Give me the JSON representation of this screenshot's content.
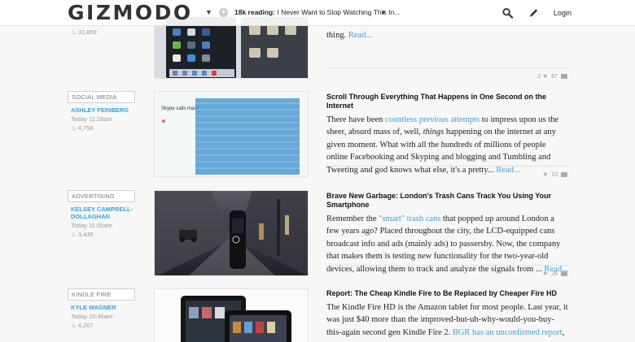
{
  "header": {
    "logo": "GIZMODO",
    "reading_count": "18k reading:",
    "reading_title": "I Never Want to Stop Watching This In...",
    "login": "Login"
  },
  "top_partial": {
    "views": "31,859",
    "body_tail": "thing.",
    "read_more": "Read...",
    "stars": "2",
    "comments": "67"
  },
  "articles": [
    {
      "category": "SOCIAL MEDIA",
      "author": "ASHLEY FEINBERG",
      "time": "Today 11:28am",
      "views": "4,756",
      "title": "Scroll Through Everything That Happens in One Second on the Internet",
      "body_pre": "There have been ",
      "link": "countless previous attempts",
      "body_post": " to impress upon us the sheer, absurd mass of, well, ",
      "em": "things",
      "body_end": " happening on the internet at any given moment. What with all the hundreds of millions of people online Facebooking and Skyping and blogging and Tumbling and Tweeting and god knows what else, it's a pretty... ",
      "read_more": "Read...",
      "comments": "13",
      "thumb_caption": "Skype calls made"
    },
    {
      "category": "ADVERTISING",
      "author": "KELSEY CAMPBELL-DOLLAGHAN",
      "time": "Today 11:00am",
      "views": "3,436",
      "title": "Brave New Garbage: London's Trash Cans Track You Using Your Smartphone",
      "body_pre": "Remember the ",
      "link": "\"smart\" trash cans",
      "body_post": " that popped up around London a few years ago? Placed throughout the city, the LCD-equipped cans broadcast info and ads (mainly ads) to passersby. Now, the company that makes them is testing new functionality for the two-year-old devices, allowing them to track and analyze the signals from ... ",
      "read_more": "Read...",
      "comments": "26"
    },
    {
      "category": "KINDLE FIRE",
      "author": "KYLE WAGNER",
      "time": "Today 10:46am",
      "views": "4,267",
      "title": "Report: The Cheap Kindle Fire to Be Replaced by Cheaper Fire HD",
      "body_pre": "The Kindle Fire HD is the Amazon tablet for most people. Last year, it was just $40 more than the improved-but-uh-why-would-you-buy-this-again second gen Kindle Fire 2. ",
      "link": "BGR has an unconfirmed report",
      "body_post": ","
    }
  ],
  "colors": {
    "accent": "#3aa0d8",
    "text": "#222222",
    "background": "#f7f7f7"
  }
}
